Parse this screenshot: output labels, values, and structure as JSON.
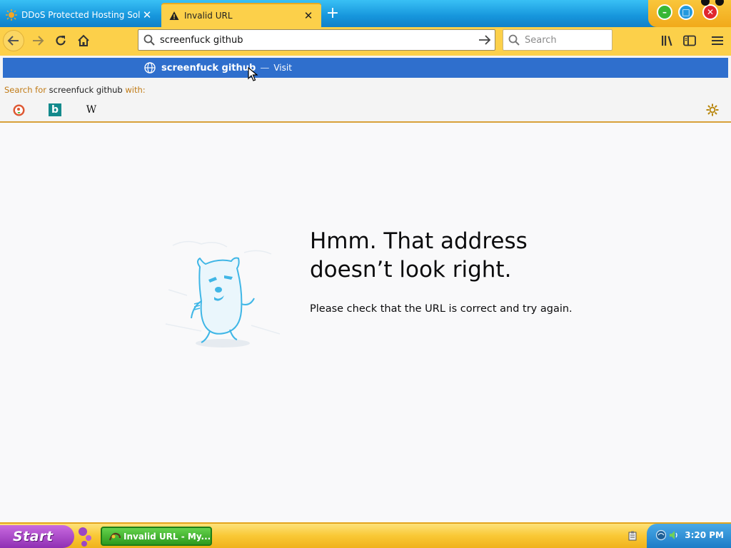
{
  "tabs": [
    {
      "label": "DDoS Protected Hosting Solu",
      "icon": "sun-favicon-icon",
      "close": "✕"
    },
    {
      "label": "Invalid URL",
      "icon": "warning-icon",
      "close": "✕"
    }
  ],
  "window_controls": {
    "minimize": "–",
    "maximize": "□",
    "close": "✕"
  },
  "toolbar": {
    "url_value": "screenfuck github",
    "search_placeholder": "Search"
  },
  "dropdown": {
    "suggestion_text": "screenfuck github",
    "suggestion_dash": "—",
    "suggestion_action": "Visit",
    "search_with_prefix": "Search for",
    "search_with_query": "screenfuck github",
    "search_with_suffix": "with:",
    "engines": [
      "duckduckgo-icon",
      "bing-icon",
      "wikipedia-icon"
    ],
    "wikipedia_letter": "W",
    "bing_letter": "b"
  },
  "error_page": {
    "title": "Hmm. That address doesn’t look right.",
    "description": "Please check that the URL is correct and try again."
  },
  "taskbar": {
    "start_label": "Start",
    "window_label": "Invalid URL - My...",
    "clock": "3:20 PM"
  },
  "colors": {
    "tab_strip": "#1696dc",
    "toolbar": "#fcd04a",
    "highlight": "#2f6fcd",
    "taskbar": "#f9c835",
    "start": "#8f2fb3"
  }
}
